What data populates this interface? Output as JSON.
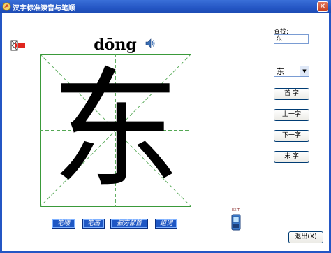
{
  "window": {
    "title": "汉字标准读音与笔顺",
    "close_symbol": "✕"
  },
  "character": {
    "glyph": "东",
    "pinyin": "dōng"
  },
  "tabs": [
    {
      "label": "笔顺"
    },
    {
      "label": "笔画"
    },
    {
      "label": "偏旁部首"
    },
    {
      "label": "组词"
    }
  ],
  "exit_icon": {
    "label": "EXIT"
  },
  "search": {
    "label": "查找:",
    "value": "东"
  },
  "select": {
    "value": "东"
  },
  "nav": {
    "first": "首 字",
    "prev": "上一字",
    "next": "下一字",
    "last": "末 字"
  },
  "quit": "退出(X)",
  "colors": {
    "title_bar": "#2456c4",
    "grid_border": "#3a9a3a",
    "grid_guide": "#54a854",
    "tab_bg": "#1f57c4"
  }
}
